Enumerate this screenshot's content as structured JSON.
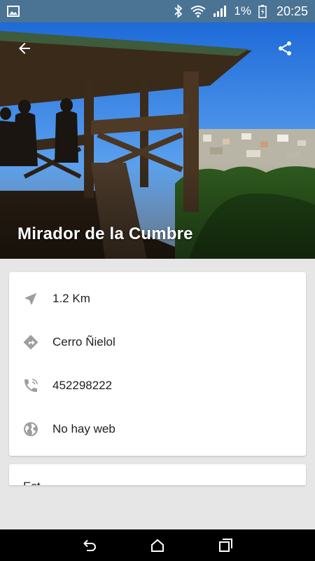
{
  "status_bar": {
    "battery_percent": "1%",
    "time": "20:25",
    "icons": [
      "image-notification-icon",
      "bluetooth-icon",
      "wifi-icon",
      "signal-icon",
      "battery-charging-icon"
    ]
  },
  "place": {
    "title": "Mirador de la Cumbre",
    "hero_image": "gazebo-viewpoint-photo"
  },
  "toolbar": {
    "back_icon": "arrow-back-icon",
    "share_icon": "share-icon"
  },
  "details": [
    {
      "icon": "navigation-arrow-icon",
      "text": "1.2 Km"
    },
    {
      "icon": "directions-icon",
      "text": "Cerro Ñielol"
    },
    {
      "icon": "phone-icon",
      "text": "452298222"
    },
    {
      "icon": "globe-icon",
      "text": "No hay web"
    }
  ],
  "second_card": {
    "partial_text": "Est"
  },
  "navigation": {
    "icons": [
      "back-nav-icon",
      "home-nav-icon",
      "recents-nav-icon"
    ]
  },
  "colors": {
    "status_bar": "#4a7394",
    "icon_gray": "#9e9e9e",
    "background": "#e6e6e6"
  }
}
